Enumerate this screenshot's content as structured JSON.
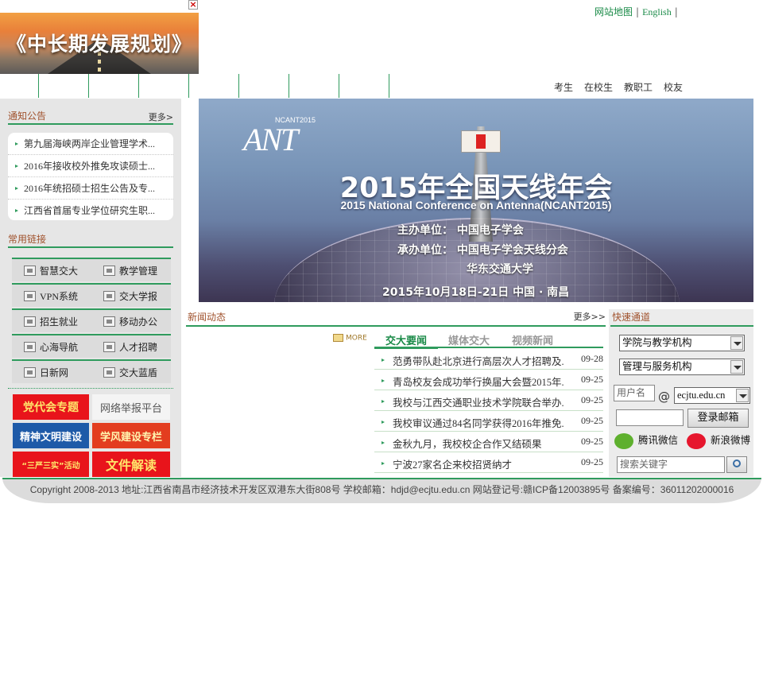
{
  "popup": {
    "title": "《中长期发展规划》",
    "close": "×"
  },
  "toplinks": {
    "sitemap": "网站地图",
    "english": "English",
    "sep": "|"
  },
  "usernav": [
    "考生",
    "在校生",
    "教职工",
    "校友"
  ],
  "notice": {
    "title": "通知公告",
    "more": "更多>",
    "items": [
      "第九届海峡两岸企业管理学术...",
      "2016年接收校外推免攻读硕士...",
      "2016年统招硕士招生公告及专...",
      "江西省首届专业学位研究生职..."
    ]
  },
  "links": {
    "title": "常用链接",
    "rows": [
      [
        "智慧交大",
        "教学管理"
      ],
      [
        "VPN系统",
        "交大学报"
      ],
      [
        "招生就业",
        "移动办公"
      ],
      [
        "心海导航",
        "人才招聘"
      ],
      [
        "日新网",
        "交大蓝盾"
      ]
    ]
  },
  "banners": [
    "党代会专题",
    "网络举报平台",
    "精神文明建设",
    "学风建设专栏",
    "“三严三实”活动",
    "文件解读"
  ],
  "hero": {
    "logo_small": "NCANT2015",
    "logo_big": "ANT",
    "title": "2015年全国天线年会",
    "subtitle": "2015 National Conference on Antenna(NCANT2015)",
    "host": "主办单位： 中国电子学会",
    "organizer": "承办单位： 中国电子学会天线分会",
    "organizer2": "华东交通大学",
    "date": "2015年10月18日-21日  中国 · 南昌"
  },
  "news": {
    "title": "新闻动态",
    "more": "更多>>",
    "more_small": "MORE",
    "tabs": [
      "交大要闻",
      "媒体交大",
      "视频新闻"
    ],
    "items": [
      {
        "title": "范勇带队赴北京进行高层次人才招聘及...",
        "date": "09-28"
      },
      {
        "title": "青岛校友会成功举行换届大会暨2015年...",
        "date": "09-25"
      },
      {
        "title": "我校与江西交通职业技术学院联合举办...",
        "date": "09-25"
      },
      {
        "title": "我校审议通过84名同学获得2016年推免...",
        "date": "09-25"
      },
      {
        "title": "金秋九月，我校校企合作又结硕果",
        "date": "09-25"
      },
      {
        "title": "宁波27家名企来校招贤纳才",
        "date": "09-25"
      }
    ]
  },
  "quick": {
    "title": "快速通道",
    "select1": "学院与教学机构",
    "select2": "管理与服务机构",
    "username_placeholder": "用户名",
    "at": "@",
    "domain": "ecjtu.edu.cn",
    "login_button": "登录邮箱",
    "wechat": "腾讯微信",
    "weibo": "新浪微博",
    "search_placeholder": "搜索关键字"
  },
  "footer": "Copyright 2008-2013 地址:江西省南昌市经济技术开发区双港东大街808号 学校邮箱：hdjd@ecjtu.edu.cn 网站登记号:赣ICP备12003895号 备案编号：36011202000016",
  "colors": {
    "accent": "#2f9b5d",
    "section_title": "#a0522d",
    "link": "#198a47"
  }
}
